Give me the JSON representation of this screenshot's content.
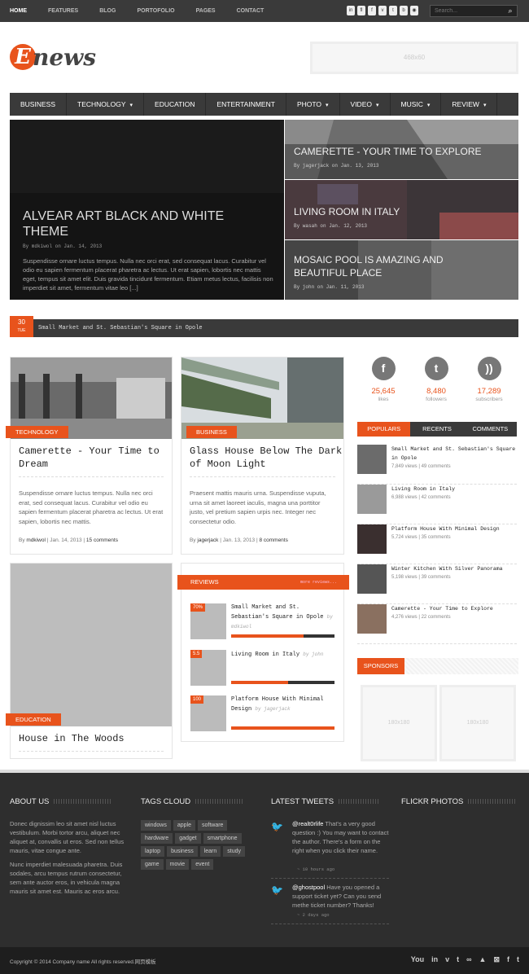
{
  "topnav": [
    "HOME",
    "FEATURES",
    "BLOG",
    "PORTOFOLIO",
    "PAGES",
    "CONTACT"
  ],
  "social_top": [
    "in",
    "fl",
    "f",
    "v",
    "t",
    "b",
    "rss"
  ],
  "search": {
    "placeholder": "Search...",
    "icon": "search-icon"
  },
  "logo": {
    "letter": "E",
    "text": "news"
  },
  "banner": {
    "label": "468x60"
  },
  "mainnav": [
    {
      "label": "BUSINESS",
      "dropdown": false
    },
    {
      "label": "TECHNOLOGY",
      "dropdown": true
    },
    {
      "label": "EDUCATION",
      "dropdown": false
    },
    {
      "label": "ENTERTAINMENT",
      "dropdown": false
    },
    {
      "label": "PHOTO",
      "dropdown": true
    },
    {
      "label": "VIDEO",
      "dropdown": true
    },
    {
      "label": "MUSIC",
      "dropdown": true
    },
    {
      "label": "REVIEW",
      "dropdown": true
    }
  ],
  "hero": {
    "main": {
      "title": "ALVEAR ART BLACK AND WHITE THEME",
      "meta": "By mdkiwol on Jan. 14, 2013",
      "excerpt": "Suspendisse ornare luctus tempus. Nulla nec orci erat, sed consequat lacus. Curabitur vel odio eu sapien fermentum placerat pharetra ac lectus. Ut erat sapien, lobortis nec mattis eget, tempus sit amet elit. Duis gravida tincidunt fermentum. Etiam metus lectus, facilisis non imperdiet sit amet, fermentum vitae leo [...]"
    },
    "side": [
      {
        "title": "CAMERETTE - YOUR TIME TO EXPLORE",
        "meta": "By jagerjack on Jan. 13, 2013"
      },
      {
        "title": "LIVING ROOM IN ITALY",
        "meta": "By wasah on Jan. 12, 2013"
      },
      {
        "title": "MOSAIC POOL IS AMAZING AND BEAUTIFUL PLACE",
        "meta": "By john on Jan. 11, 2013"
      }
    ]
  },
  "ticker": {
    "day": "30",
    "weekday": "TUE",
    "text": "Small Market and St. Sebastian's Square in Opole"
  },
  "cards": [
    {
      "category": "TECHNOLOGY",
      "title": "Camerette - Your Time to Dream",
      "excerpt": "Suspendisse ornare luctus tempus. Nulla nec orci erat, sed consequat lacus. Curabitur vel odio eu sapien fermentum placerat pharetra ac lectus. Ut erat sapien, lobortis nec mattis.",
      "by": "By",
      "author": "mdkiwol",
      "date": "Jan. 14, 2013",
      "comments": "15 comments"
    },
    {
      "category": "BUSINESS",
      "title": "Glass House Below The Dark of Moon Light",
      "excerpt": "Praesent mattis mauris urna. Suspendisse vuputa, urna sit amet laoreet iaculis, magna una porttitor justo, vel pretium sapien urpis nec. Integer nec consectetur odio.",
      "by": "By",
      "author": "jagerjack",
      "date": "Jan. 13, 2013",
      "comments": "8 comments"
    },
    {
      "category": "EDUCATION",
      "title": "House in The Woods"
    }
  ],
  "reviews": {
    "label": "REVIEWS",
    "more": "more reviews...",
    "items": [
      {
        "score": "70%",
        "title": "Small Market and St. Sebastian's Square in Opole",
        "author": "by mdkiwol",
        "value": 0.7
      },
      {
        "score": "5.5",
        "title": "Living Room in Italy",
        "author": "by john",
        "value": 0.55
      },
      {
        "score": "100",
        "title": "Platform House With Minimal Design",
        "author": "by jagerjack",
        "value": 1.0
      }
    ]
  },
  "social_counts": [
    {
      "icon": "facebook-icon",
      "glyph": "f",
      "count": "25,645",
      "label": "likes"
    },
    {
      "icon": "twitter-icon",
      "glyph": "t",
      "count": "8,480",
      "label": "followers"
    },
    {
      "icon": "rss-icon",
      "glyph": "))",
      "count": "17,289",
      "label": "subscribers"
    }
  ],
  "tabs": [
    "POPULARS",
    "RECENTS",
    "COMMENTS"
  ],
  "popular": [
    {
      "title": "Small Market and St. Sebastian's Square in Opole",
      "views": "7,849 views",
      "comments": "49 comments"
    },
    {
      "title": "Living Room in Italy",
      "views": "6,988 views",
      "comments": "42 comments"
    },
    {
      "title": "Platform House With Minimal Design",
      "views": "5,724 views",
      "comments": "35 comments"
    },
    {
      "title": "Winter Kitchen With Silver Panorama",
      "views": "5,198 views",
      "comments": "39 comments"
    },
    {
      "title": "Camerette - Your Time to Explore",
      "views": "4,276 views",
      "comments": "22 comments"
    }
  ],
  "sponsors": {
    "label": "SPONSORS",
    "items": [
      "180x180",
      "180x180"
    ]
  },
  "footer": {
    "about": {
      "title": "ABOUT US",
      "p1": "Donec dignissim leo sit amet nisl luctus vestibulum. Morbi tortor arcu, aliquet nec aliquet at, convallis ut eros. Sed non tellus mauris, vitae congue ante.",
      "p2": "Nunc imperdiet malesuada pharetra. Duis sodales, arcu tempus rutrum consectetur, sem ante auctor eros, in vehicula magna mauris sit amet est. Mauris ac eros arcu."
    },
    "tags": {
      "title": "TAGS CLOUD",
      "items": [
        "windows",
        "apple",
        "software",
        "hardware",
        "gadget",
        "smartphone",
        "laptop",
        "business",
        "learn",
        "study",
        "game",
        "movie",
        "event"
      ]
    },
    "tweets": {
      "title": "LATEST TWEETS",
      "items": [
        {
          "user": "@realt0rlife",
          "text": " That's a very good question :) You may want to contact the author. There's a form on the right when you click their name.",
          "time": "~ 10 hours ago"
        },
        {
          "user": "@ghostpool",
          "text": " Have you opened a support ticket yet? Can you send methe ticket number? Thanks!",
          "time": "~ 2 days ago"
        }
      ]
    },
    "flickr": {
      "title": "FLICKR PHOTOS"
    }
  },
  "bottom": {
    "copyright": "Copyright © 2014 Company name All rights reserved.网页模板",
    "icons": [
      "You",
      "in",
      "v",
      "t",
      "∞",
      "▲",
      "⊠",
      "f",
      "t"
    ]
  },
  "colors": {
    "accent": "#e8531c",
    "dark": "#3a3a3a"
  }
}
